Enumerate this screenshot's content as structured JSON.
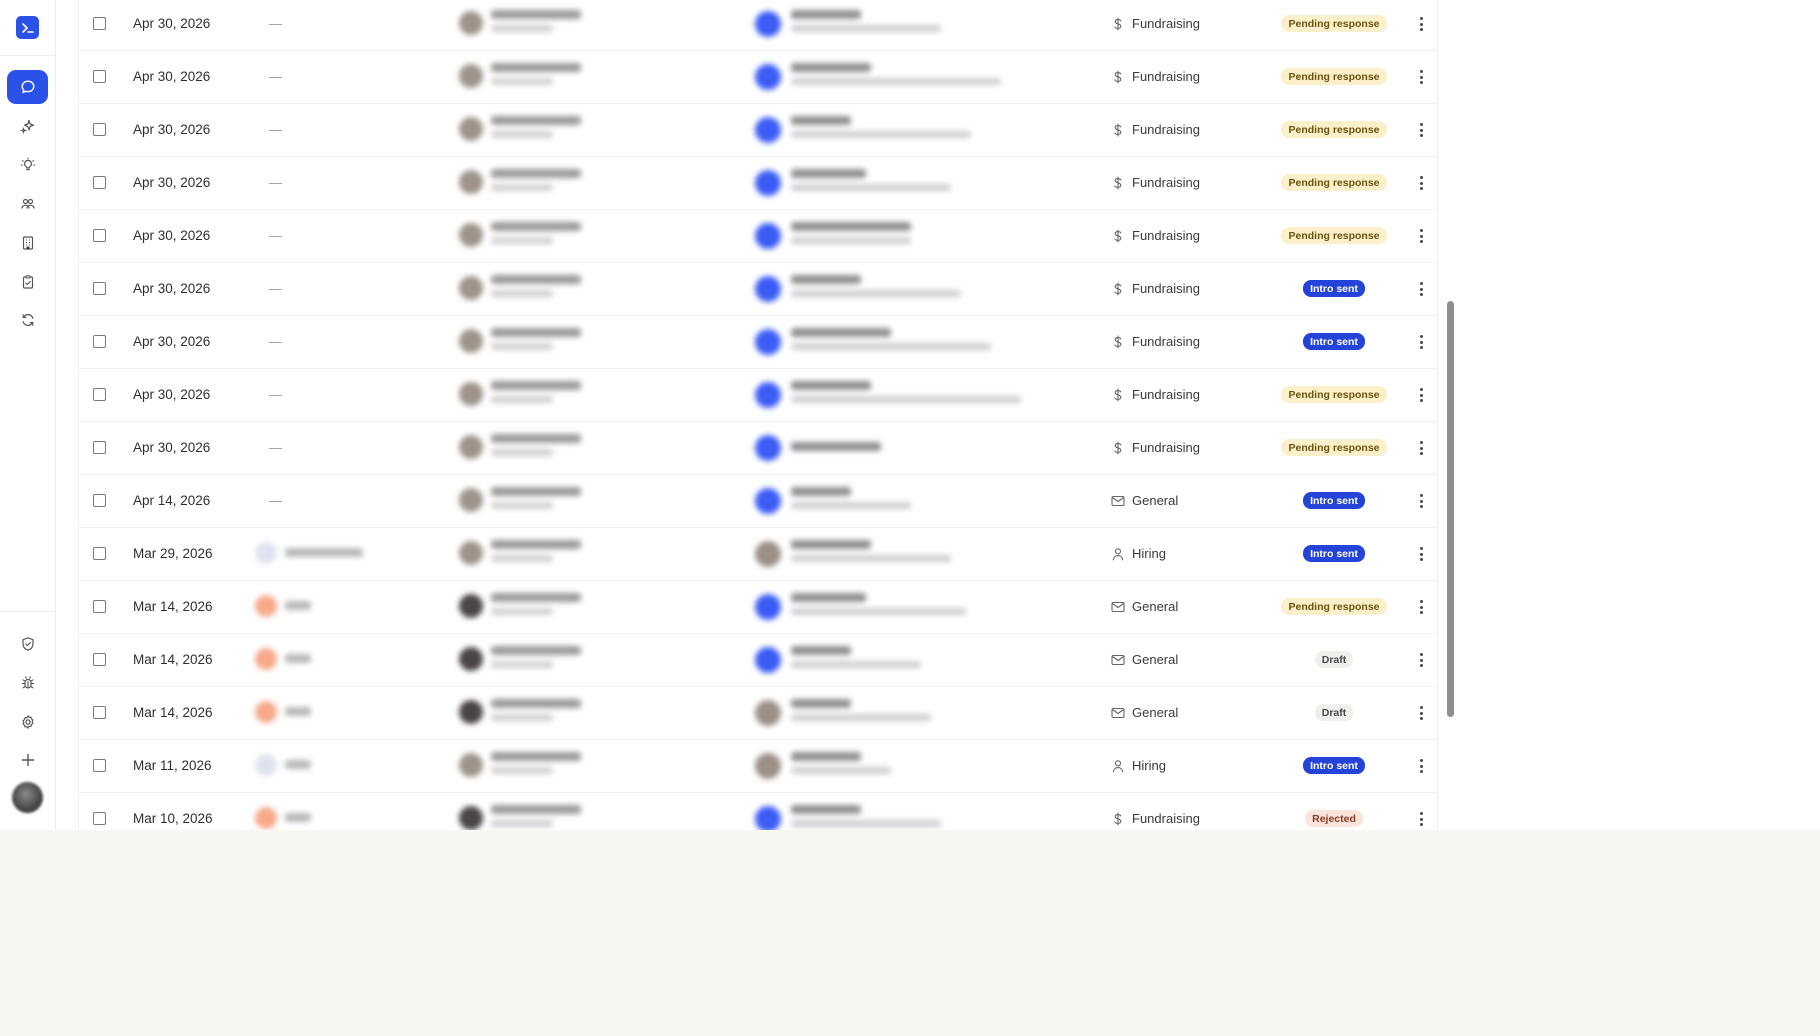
{
  "sidebar": {
    "top_icons": [
      "terminal-icon",
      "chat-icon",
      "sparkles-icon",
      "lightbulb-icon",
      "users-icon",
      "building-icon",
      "clipboard-check-icon",
      "refresh-icon"
    ],
    "bottom_icons": [
      "shield-icon",
      "bug-icon",
      "gear-icon",
      "plus-icon"
    ],
    "active": "chat-icon",
    "accent": "#2a51e8"
  },
  "rows": [
    {
      "date": "Apr 30, 2026",
      "referrer": "—",
      "type": "Fundraising",
      "type_icon": "dollar-icon",
      "status": "Pending response",
      "status_kind": "pending"
    },
    {
      "date": "Apr 30, 2026",
      "referrer": "—",
      "type": "Fundraising",
      "type_icon": "dollar-icon",
      "status": "Pending response",
      "status_kind": "pending"
    },
    {
      "date": "Apr 30, 2026",
      "referrer": "—",
      "type": "Fundraising",
      "type_icon": "dollar-icon",
      "status": "Pending response",
      "status_kind": "pending"
    },
    {
      "date": "Apr 30, 2026",
      "referrer": "—",
      "type": "Fundraising",
      "type_icon": "dollar-icon",
      "status": "Pending response",
      "status_kind": "pending"
    },
    {
      "date": "Apr 30, 2026",
      "referrer": "—",
      "type": "Fundraising",
      "type_icon": "dollar-icon",
      "status": "Pending response",
      "status_kind": "pending"
    },
    {
      "date": "Apr 30, 2026",
      "referrer": "—",
      "type": "Fundraising",
      "type_icon": "dollar-icon",
      "status": "Intro sent",
      "status_kind": "intro"
    },
    {
      "date": "Apr 30, 2026",
      "referrer": "—",
      "type": "Fundraising",
      "type_icon": "dollar-icon",
      "status": "Intro sent",
      "status_kind": "intro"
    },
    {
      "date": "Apr 30, 2026",
      "referrer": "—",
      "type": "Fundraising",
      "type_icon": "dollar-icon",
      "status": "Pending response",
      "status_kind": "pending"
    },
    {
      "date": "Apr 30, 2026",
      "referrer": "—",
      "type": "Fundraising",
      "type_icon": "dollar-icon",
      "status": "Pending response",
      "status_kind": "pending"
    },
    {
      "date": "Apr 14, 2026",
      "referrer": "—",
      "type": "General",
      "type_icon": "mail-icon",
      "status": "Intro sent",
      "status_kind": "intro"
    },
    {
      "date": "Mar 29, 2026",
      "referrer": "",
      "type": "Hiring",
      "type_icon": "person-icon",
      "status": "Intro sent",
      "status_kind": "intro"
    },
    {
      "date": "Mar 14, 2026",
      "referrer": "",
      "type": "General",
      "type_icon": "mail-icon",
      "status": "Pending response",
      "status_kind": "pending"
    },
    {
      "date": "Mar 14, 2026",
      "referrer": "",
      "type": "General",
      "type_icon": "mail-icon",
      "status": "Draft",
      "status_kind": "draft"
    },
    {
      "date": "Mar 14, 2026",
      "referrer": "",
      "type": "General",
      "type_icon": "mail-icon",
      "status": "Draft",
      "status_kind": "draft"
    },
    {
      "date": "Mar 11, 2026",
      "referrer": "",
      "type": "Hiring",
      "type_icon": "person-icon",
      "status": "Intro sent",
      "status_kind": "intro"
    },
    {
      "date": "Mar 10, 2026",
      "referrer": "",
      "type": "Fundraising",
      "type_icon": "dollar-icon",
      "status": "Rejected",
      "status_kind": "rejected"
    }
  ]
}
